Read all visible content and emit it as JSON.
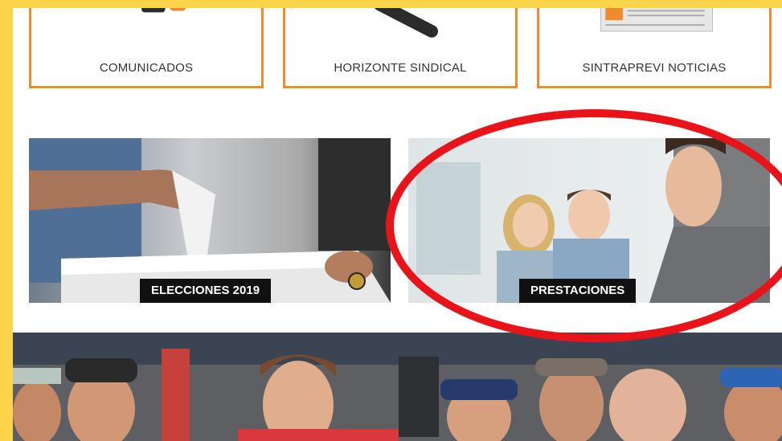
{
  "categories": [
    {
      "label": "COMUNICADOS",
      "icon": "megaphone-icon"
    },
    {
      "label": "HORIZONTE SINDICAL",
      "icon": "telescope-icon"
    },
    {
      "label": "SINTRAPREVI NOTICIAS",
      "icon": "newspaper-icon"
    }
  ],
  "tiles": [
    {
      "caption": "ELECCIONES 2019"
    },
    {
      "caption": "PRESTACIONES"
    }
  ],
  "colors": {
    "accent_orange": "#ef8a2e",
    "frame_yellow": "#fbd44a",
    "highlight_red": "#e8141a",
    "caption_bg": "#111111"
  }
}
